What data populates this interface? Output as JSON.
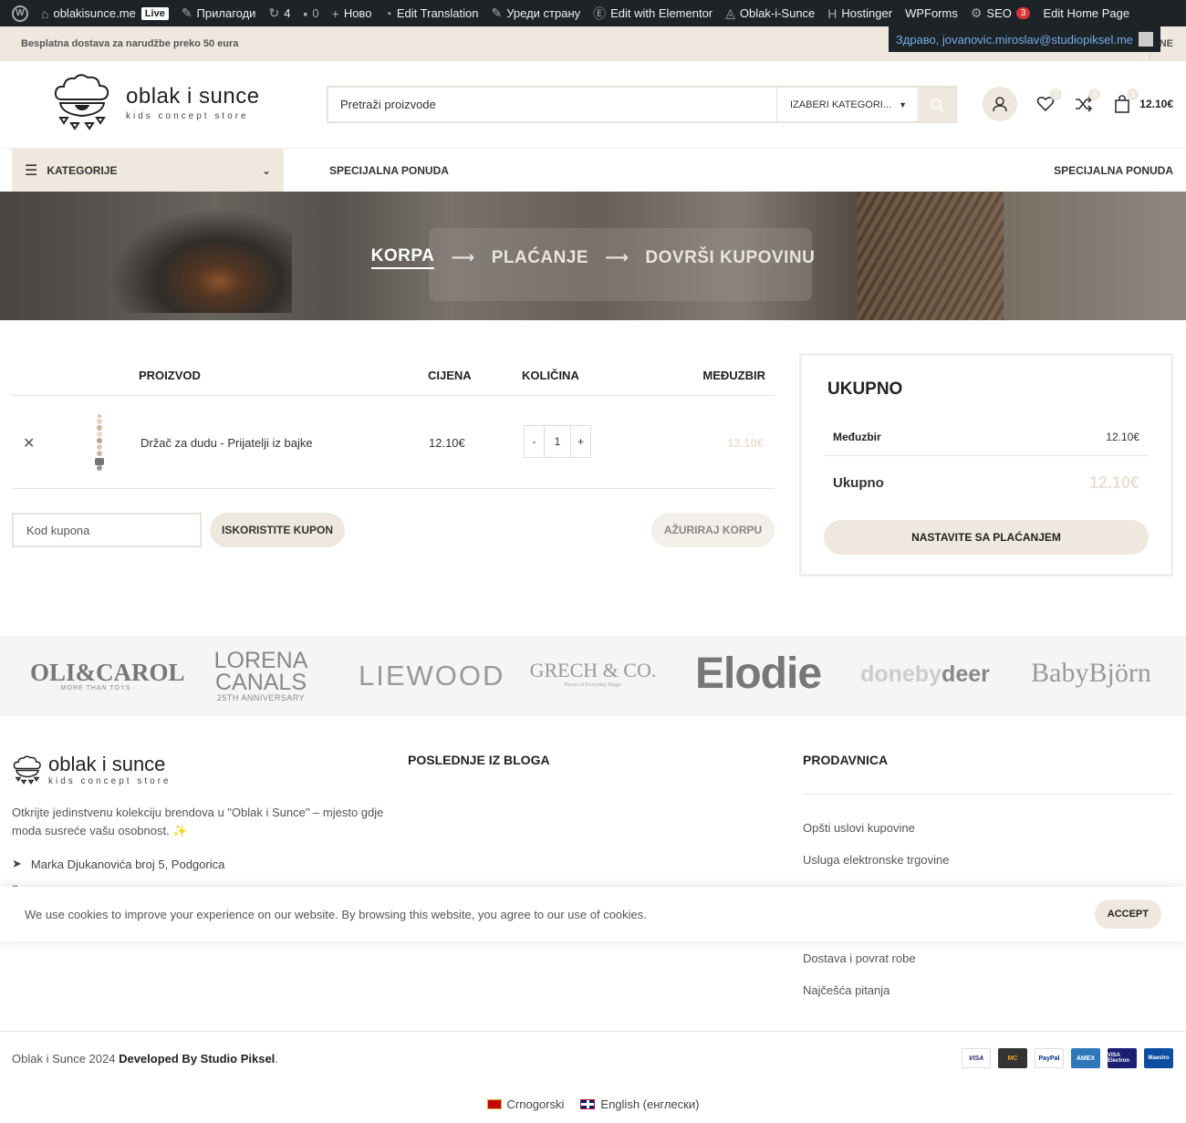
{
  "admin_bar": {
    "site": "oblakisunce.me",
    "live": "Live",
    "customize": "Прилагоди",
    "updates": "4",
    "comments": "0",
    "new": "Ново",
    "translation": "Edit Translation",
    "edit_page": "Уреди страну",
    "elementor": "Edit with Elementor",
    "oblak": "Oblak-i-Sunce",
    "hostinger": "Hostinger",
    "wpforms": "WPForms",
    "seo": "SEO",
    "seo_count": "3",
    "home": "Edit Home Page",
    "account": "Здраво, jovanovic.miroslav@studiopiksel.me"
  },
  "topbar": {
    "promo": "Besplatna dostava za narudžbe preko 50 eura",
    "nav_partial": "NE"
  },
  "header": {
    "logo_line1": "oblak i sunce",
    "logo_line2": "kids concept store",
    "search_placeholder": "Pretraži proizvode",
    "category_select": "IZABERI KATEGORI...",
    "cart_total": "12.10€"
  },
  "nav": {
    "categories": "KATEGORIJE",
    "special_left": "SPECIJALNA PONUDA",
    "special_right": "SPECIJALNA PONUDA"
  },
  "steps": {
    "cart": "KORPA",
    "checkout": "PLAĆANJE",
    "complete": "DOVRŠI KUPOVINU"
  },
  "cart": {
    "headers": {
      "product": "PROIZVOD",
      "price": "CIJENA",
      "quantity": "KOLIČINA",
      "subtotal": "MEĐUZBIR"
    },
    "items": [
      {
        "name": "Držač za dudu - Prijatelji iz bajke",
        "price": "12.10€",
        "qty": "1",
        "subtotal": "12.10€"
      }
    ],
    "coupon_placeholder": "Kod kupona",
    "apply_coupon": "ISKORISTITE KUPON",
    "update_cart": "AŽURIRAJ KORPU"
  },
  "totals": {
    "title": "UKUPNO",
    "subtotal_label": "Međuzbir",
    "subtotal_value": "12.10€",
    "total_label": "Ukupno",
    "total_value": "12.10€",
    "checkout": "NASTAVITE SA PLAĆANJEM"
  },
  "brands": {
    "oli_carol": "OLI&CAROL",
    "oli_carol_sub": "· MORE THAN TOYS ·",
    "lorena_1": "LORENA",
    "lorena_2": "CANALS",
    "lorena_sub": "25TH ANNIVERSARY",
    "liewood": "LIEWOOD",
    "grech": "GRECH & CO.",
    "grech_sub": "Pieces of Everyday Magic",
    "elodie": "Elodie",
    "doneby_1": "doneby",
    "doneby_2": "deer",
    "babybjorn": "BabyBjörn"
  },
  "footer": {
    "description": "Otkrijte jedinstvenu kolekciju brendova u \"Oblak i Sunce\" – mjesto gdje moda susreće vašu osobnost. ✨",
    "address": "Marka Djukanovića broj 5, Podgorica",
    "blog_heading": "POSLEDNJE IZ BLOGA",
    "shop_heading": "PRODAVNICA",
    "links": {
      "terms": "Opšti uslovi kupovine",
      "ecommerce": "Usluga elektronske trgovine",
      "delivery": "Dostava i povrat robe",
      "faq": "Najčešća pitanja"
    }
  },
  "cookie": {
    "text": "We use cookies to improve your experience on our website. By browsing this website, you agree to our use of cookies.",
    "accept": "ACCEPT"
  },
  "bottom": {
    "copyright": "Oblak i Sunce 2024 ",
    "developer": "Developed By Studio Piksel",
    "period": ".",
    "payments": [
      "VISA",
      "MC",
      "PayPal",
      "AMEX",
      "VISA Electron",
      "Maestro"
    ],
    "lang_me": "Crnogorski",
    "lang_en": "English (енглески)"
  }
}
